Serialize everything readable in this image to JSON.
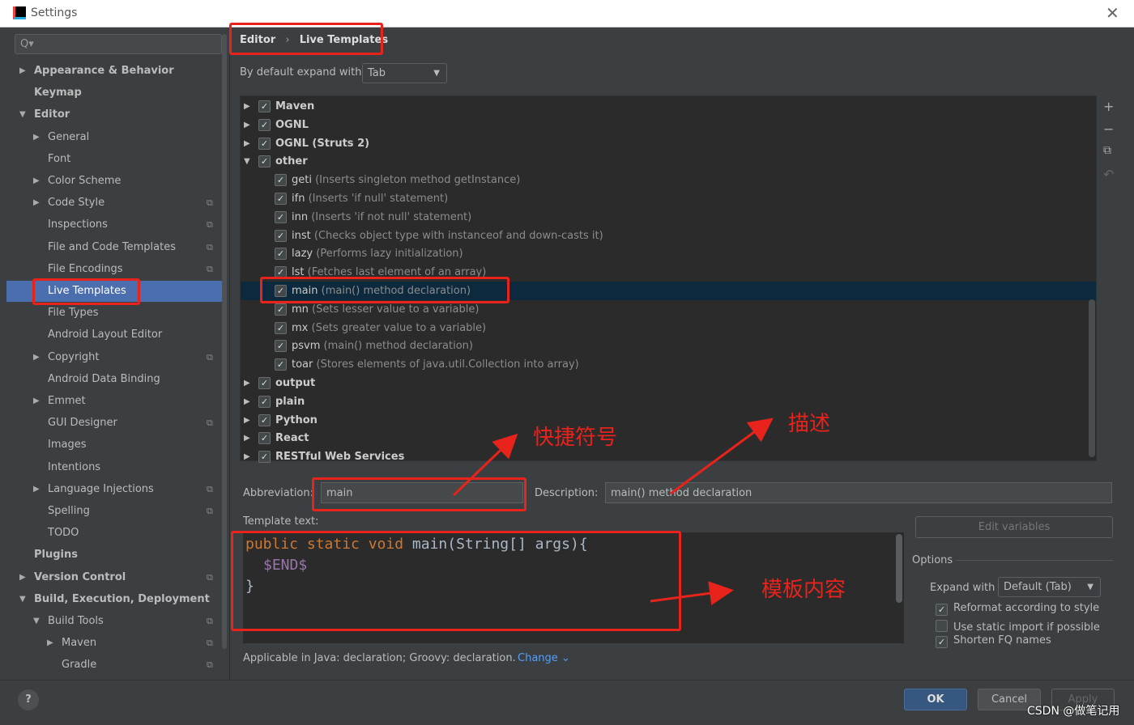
{
  "window": {
    "title": "Settings",
    "close": "✕"
  },
  "search": {
    "icon": "search-icon",
    "placeholder": "Q▾"
  },
  "sidebar": {
    "items": [
      {
        "label": "Appearance & Behavior",
        "level": 0,
        "arrow": "▶",
        "bold": true
      },
      {
        "label": "Keymap",
        "level": 0,
        "bold": true
      },
      {
        "label": "Editor",
        "level": 0,
        "arrow": "▼",
        "bold": true
      },
      {
        "label": "General",
        "level": 1,
        "arrow": "▶"
      },
      {
        "label": "Font",
        "level": 1
      },
      {
        "label": "Color Scheme",
        "level": 1,
        "arrow": "▶"
      },
      {
        "label": "Code Style",
        "level": 1,
        "arrow": "▶",
        "copy": true
      },
      {
        "label": "Inspections",
        "level": 1,
        "copy": true
      },
      {
        "label": "File and Code Templates",
        "level": 1,
        "copy": true
      },
      {
        "label": "File Encodings",
        "level": 1,
        "copy": true
      },
      {
        "label": "Live Templates",
        "level": 1,
        "selected": true
      },
      {
        "label": "File Types",
        "level": 1
      },
      {
        "label": "Android Layout Editor",
        "level": 1
      },
      {
        "label": "Copyright",
        "level": 1,
        "arrow": "▶",
        "copy": true
      },
      {
        "label": "Android Data Binding",
        "level": 1
      },
      {
        "label": "Emmet",
        "level": 1,
        "arrow": "▶"
      },
      {
        "label": "GUI Designer",
        "level": 1,
        "copy": true
      },
      {
        "label": "Images",
        "level": 1
      },
      {
        "label": "Intentions",
        "level": 1
      },
      {
        "label": "Language Injections",
        "level": 1,
        "arrow": "▶",
        "copy": true
      },
      {
        "label": "Spelling",
        "level": 1,
        "copy": true
      },
      {
        "label": "TODO",
        "level": 1
      },
      {
        "label": "Plugins",
        "level": 0,
        "bold": true
      },
      {
        "label": "Version Control",
        "level": 0,
        "arrow": "▶",
        "bold": true,
        "copy": true
      },
      {
        "label": "Build, Execution, Deployment",
        "level": 0,
        "arrow": "▼",
        "bold": true
      },
      {
        "label": "Build Tools",
        "level": 1,
        "arrow": "▼",
        "copy": true
      },
      {
        "label": "Maven",
        "level": 2,
        "arrow": "▶",
        "copy": true
      },
      {
        "label": "Gradle",
        "level": 2,
        "copy": true
      }
    ]
  },
  "breadcrumb": {
    "parent": "Editor",
    "sep": "›",
    "current": "Live Templates"
  },
  "expand_default": {
    "label": "By default expand with",
    "value": "Tab"
  },
  "templates": [
    {
      "name": "Maven",
      "group": true,
      "arrow": "▶"
    },
    {
      "name": "OGNL",
      "group": true,
      "arrow": "▶"
    },
    {
      "name": "OGNL (Struts 2)",
      "group": true,
      "arrow": "▶"
    },
    {
      "name": "other",
      "group": true,
      "arrow": "▼"
    },
    {
      "name": "geti",
      "desc": "(Inserts singleton method getInstance)"
    },
    {
      "name": "ifn",
      "desc": "(Inserts 'if null' statement)"
    },
    {
      "name": "inn",
      "desc": "(Inserts 'if not null' statement)"
    },
    {
      "name": "inst",
      "desc": "(Checks object type with instanceof and down-casts it)"
    },
    {
      "name": "lazy",
      "desc": "(Performs lazy initialization)"
    },
    {
      "name": "lst",
      "desc": "(Fetches last element of an array)"
    },
    {
      "name": "main",
      "desc": "(main() method declaration)",
      "selected": true
    },
    {
      "name": "mn",
      "desc": "(Sets lesser value to a variable)"
    },
    {
      "name": "mx",
      "desc": "(Sets greater value to a variable)"
    },
    {
      "name": "psvm",
      "desc": "(main() method declaration)"
    },
    {
      "name": "toar",
      "desc": "(Stores elements of java.util.Collection into array)"
    },
    {
      "name": "output",
      "group": true,
      "arrow": "▶"
    },
    {
      "name": "plain",
      "group": true,
      "arrow": "▶"
    },
    {
      "name": "Python",
      "group": true,
      "arrow": "▶"
    },
    {
      "name": "React",
      "group": true,
      "arrow": "▶"
    },
    {
      "name": "RESTful Web Services",
      "group": true,
      "arrow": "▶"
    }
  ],
  "toolbar": {
    "add": "+",
    "remove": "−",
    "copy": "⧉",
    "revert": "↶"
  },
  "abbreviation": {
    "label": "Abbreviation:",
    "value": "main"
  },
  "description": {
    "label": "Description:",
    "value": "main() method declaration"
  },
  "template_text": {
    "label": "Template text:",
    "line1_kw": "public static void",
    "line1_rest": " main(String[] args){",
    "line2": "$END$",
    "line3": "}"
  },
  "edit_variables": "Edit variables",
  "options": {
    "title": "Options",
    "expand_label": "Expand with",
    "expand_value": "Default (Tab)",
    "checks": [
      {
        "label": "Reformat according to style",
        "checked": true
      },
      {
        "label": "Use static import if possible",
        "checked": false
      },
      {
        "label": "Shorten FQ names",
        "checked": true
      }
    ]
  },
  "applicable": {
    "text": "Applicable in Java: declaration; Groovy: declaration.",
    "change": "Change ⌄"
  },
  "buttons": {
    "help": "?",
    "ok": "OK",
    "cancel": "Cancel",
    "apply": "Apply"
  },
  "annotations": {
    "abbr": "快捷符号",
    "desc": "描述",
    "content": "模板内容",
    "color": "#e8231c"
  },
  "watermark": "CSDN @做笔记用",
  "colors": {
    "selection": "#4b6eaf",
    "ok": "#365880",
    "keyword": "#cc7832",
    "variable": "#9876aa"
  }
}
